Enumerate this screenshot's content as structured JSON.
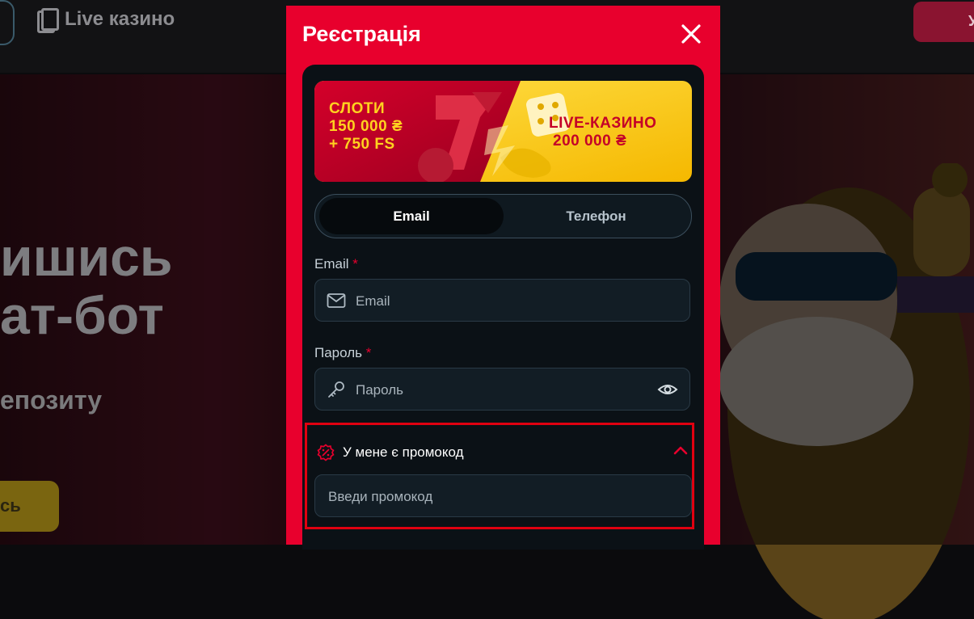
{
  "background": {
    "nav": {
      "live_casino": "Live казино",
      "right_button": "У"
    },
    "hero": {
      "title_line1": "ишись",
      "title_line2": "ат-бот",
      "subtitle": "епозиту",
      "button": "сь"
    }
  },
  "modal": {
    "title": "Реєстрація",
    "close_icon": "close-icon",
    "banner": {
      "left_line1": "СЛОТИ",
      "left_line2": "150 000 ₴",
      "left_line3": "+ 750 FS",
      "right_line1": "LIVE-КАЗИНО",
      "right_line2": "200 000 ₴"
    },
    "tabs": [
      {
        "label": "Email",
        "active": true
      },
      {
        "label": "Телефон",
        "active": false
      }
    ],
    "email": {
      "label": "Email",
      "required_mark": "*",
      "placeholder": "Email",
      "value": ""
    },
    "password": {
      "label": "Пароль",
      "required_mark": "*",
      "placeholder": "Пароль",
      "value": ""
    },
    "promo": {
      "toggle_label": "У мене є промокод",
      "placeholder": "Введи промокод",
      "value": "",
      "expanded": true
    }
  },
  "colors": {
    "accent": "#e8002d",
    "panel": "#0b1116",
    "field": "#121d25",
    "highlight_border": "#e00010"
  }
}
